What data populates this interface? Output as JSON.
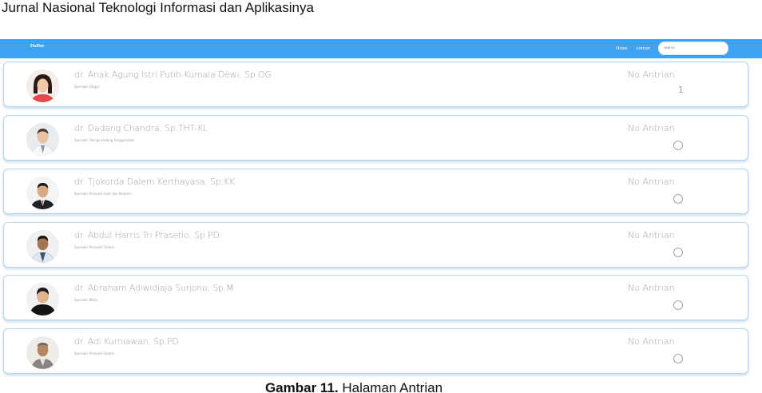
{
  "journal": {
    "title": "Jurnal Nasional Teknologi Informasi dan Aplikasinya"
  },
  "navbar": {
    "brand": "HaDoc",
    "links": [
      "Home",
      "Antrian"
    ],
    "search_placeholder": "Search",
    "color": "#3da2ef"
  },
  "queue_label": "No Antrian",
  "doctors": [
    {
      "name": "dr. Anak Agung Istri Putih Kumala Dewi, Sp.OG",
      "specialty": "Spesialis Obgyn",
      "queue": "1",
      "photo": "female-doctor"
    },
    {
      "name": "dr. Dadang Chandra, Sp.THT-KL",
      "specialty": "Spesialis Telinga Hidung Tenggorokan",
      "queue": "",
      "photo": "male-doctor-whitecoat"
    },
    {
      "name": "dr. Tjokorda Dalem Kerthayasa, Sp.KK",
      "specialty": "Spesialis Penyakit Kulit dan Kelamin",
      "queue": "",
      "photo": "male-doctor-suit"
    },
    {
      "name": "dr. Abdul Harris Tri Prasetio, Sp.PD",
      "specialty": "Spesialis Penyakit Dalam",
      "queue": "",
      "photo": "male-doctor-coat"
    },
    {
      "name": "dr. Abraham Adiwidjaja Surjono, Sp.M",
      "specialty": "Spesialis Mata",
      "queue": "",
      "photo": "male-doctor-black"
    },
    {
      "name": "dr. Adi Kurniawan, Sp.PD",
      "specialty": "Spesialis Penyakit Dalam",
      "queue": "",
      "photo": "male-doctor-older"
    }
  ],
  "caption": {
    "label": "Gambar 11.",
    "text": " Halaman Antrian"
  }
}
